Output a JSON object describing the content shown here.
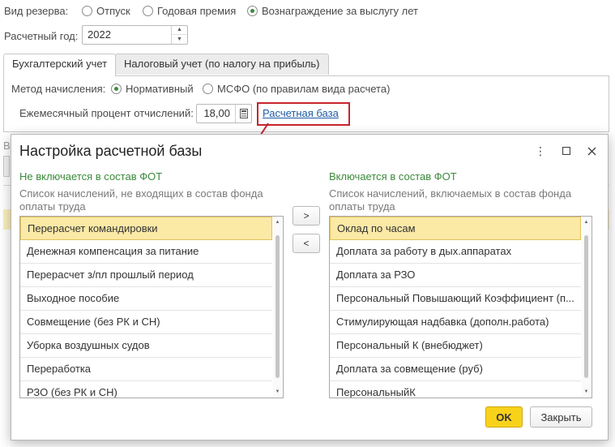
{
  "main": {
    "reserve_type_label": "Вид резерва:",
    "reserve_options": [
      "Отпуск",
      "Годовая премия",
      "Вознаграждение за выслугу лет"
    ],
    "reserve_selected_index": 2,
    "year_label": "Расчетный год:",
    "year_value": "2022",
    "tabs": [
      {
        "label": "Бухгалтерский учет",
        "active": true
      },
      {
        "label": "Налоговый учет (по налогу на прибыль)",
        "active": false
      }
    ],
    "method_label": "Метод начисления:",
    "method_options": [
      "Нормативный",
      "МСФО (по правилам вида расчета)"
    ],
    "method_selected_index": 0,
    "percent_label": "Ежемесячный процент отчислений:",
    "percent_value": "18,00",
    "base_link": "Расчетная база"
  },
  "dialog": {
    "title": "Настройка расчетной базы",
    "left": {
      "heading": "Не включается в состав ФОТ",
      "description": "Список начислений, не входящих в состав фонда оплаты труда",
      "items": [
        "Перерасчет командировки",
        "Денежная компенсация за питание",
        "Перерасчет з/пл прошлый период",
        "Выходное пособие",
        "Совмещение (без РК и СН)",
        "Уборка воздушных судов",
        "Переработка",
        "РЗО (без РК и СН)"
      ],
      "selected_index": 0
    },
    "right": {
      "heading": "Включается в состав ФОТ",
      "description": "Список начислений, включаемых в состав фонда оплаты труда",
      "items": [
        "Оклад по часам",
        "Доплата за работу в дых.аппаратах",
        "Доплата за РЗО",
        "Персональный Повышающий Коэффициент (п...",
        "Стимулирующая надбавка (дополн.работа)",
        "Персональный К (внебюджет)",
        "Доплата за совмещение (руб)",
        "ПерсональныйК"
      ],
      "selected_index": 0
    },
    "move_right_label": ">",
    "move_left_label": "<",
    "ok_label": "OK",
    "close_label": "Закрыть"
  },
  "colors": {
    "accent_green": "#3b8a3b",
    "highlight": "#c8252d",
    "selection": "#fbe9a6",
    "ok_button": "#f8d21a",
    "link": "#1d5aa5"
  }
}
